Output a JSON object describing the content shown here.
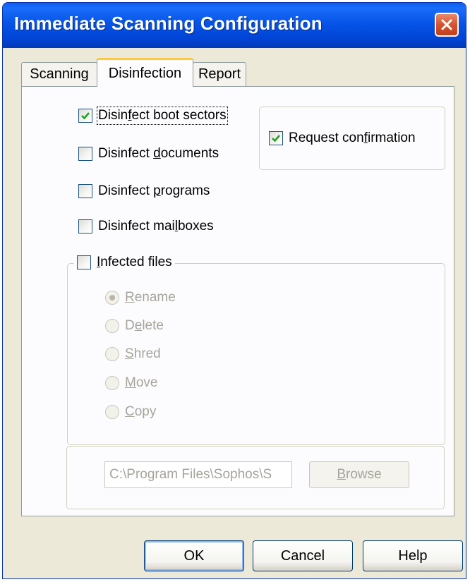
{
  "window": {
    "title": "Immediate Scanning Configuration"
  },
  "tabs": [
    {
      "label": "Scanning",
      "active": false
    },
    {
      "label": "Disinfection",
      "active": true
    },
    {
      "label": "Report",
      "active": false
    }
  ],
  "options": {
    "boot_sectors": {
      "pre": "Disin",
      "key": "f",
      "post": "ect boot sectors",
      "checked": true
    },
    "documents": {
      "pre": "Disinfect ",
      "key": "d",
      "post": "ocuments",
      "checked": false
    },
    "programs": {
      "pre": "Disinfect ",
      "key": "p",
      "post": "rograms",
      "checked": false
    },
    "mailboxes": {
      "pre": "Disinfect mai",
      "key": "l",
      "post": "boxes",
      "checked": false
    },
    "request_confirmation": {
      "pre": "Request con",
      "key": "f",
      "post": "irmation",
      "checked": true
    }
  },
  "infected_files": {
    "label": {
      "pre": "",
      "key": "I",
      "post": "nfected files"
    },
    "checked": false,
    "actions": [
      {
        "pre": "",
        "key": "R",
        "post": "ename",
        "selected": true
      },
      {
        "pre": "D",
        "key": "e",
        "post": "lete",
        "selected": false
      },
      {
        "pre": "",
        "key": "S",
        "post": "hred",
        "selected": false
      },
      {
        "pre": "",
        "key": "M",
        "post": "ove",
        "selected": false
      },
      {
        "pre": "",
        "key": "C",
        "post": "opy",
        "selected": false
      }
    ]
  },
  "move_path": {
    "value": "C:\\Program Files\\Sophos\\S",
    "browse": {
      "pre": "",
      "key": "B",
      "post": "rowse"
    }
  },
  "buttons": {
    "ok": "OK",
    "cancel": "Cancel",
    "help": "Help"
  },
  "colors": {
    "titlebar": "#0054e3",
    "dialog": "#ece9d8",
    "active_tab_accent": "#ffc83c",
    "checkmark": "#21a121",
    "disabled_text": "#a6a49a"
  },
  "icons": {
    "close": "close-icon",
    "check": "checkmark-icon"
  }
}
